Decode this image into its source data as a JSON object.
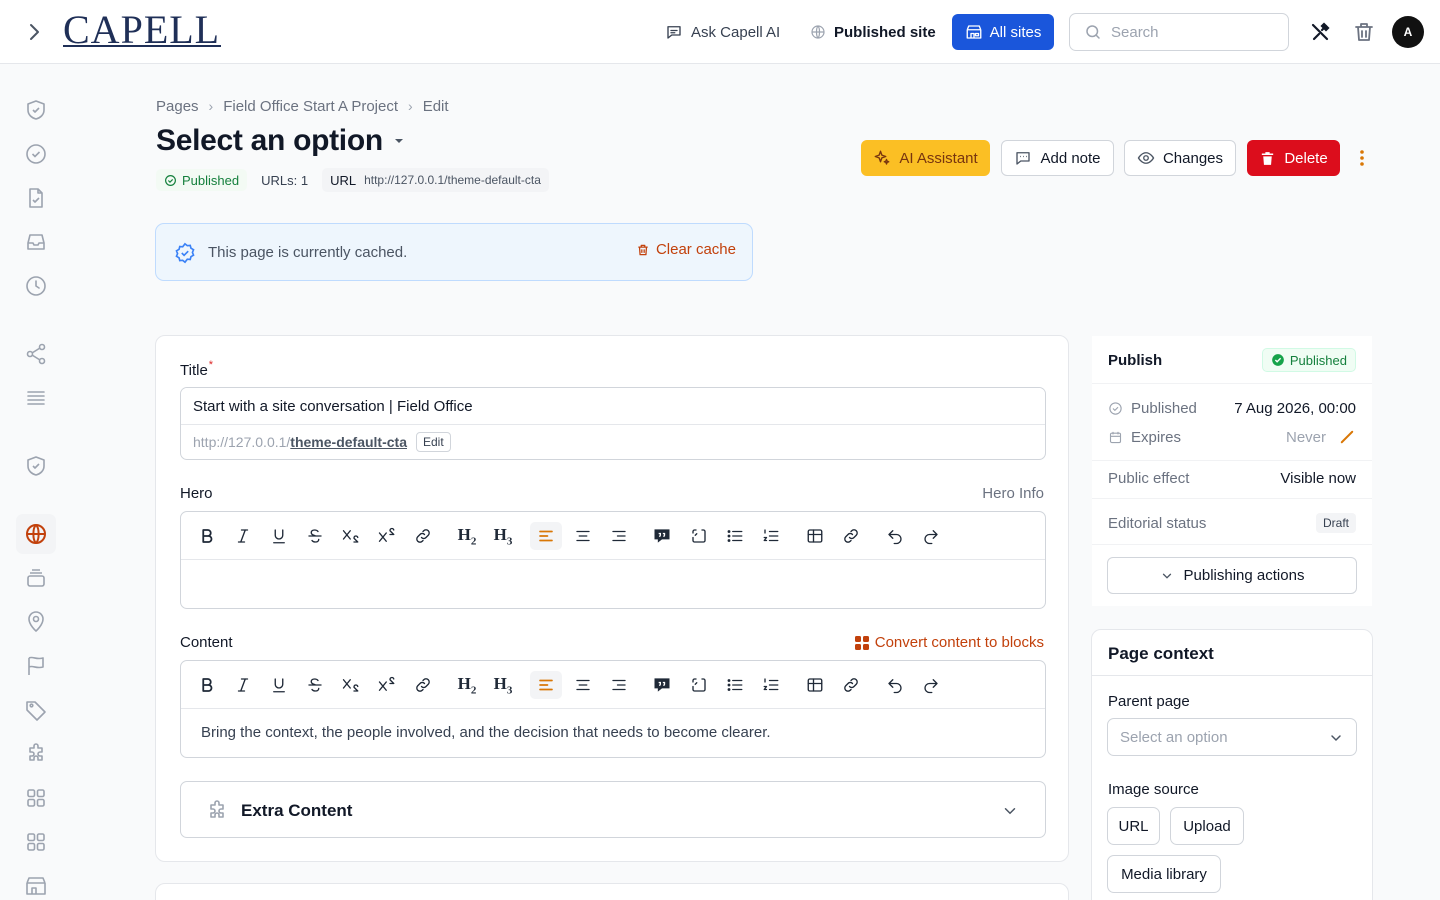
{
  "topbar": {
    "logo": "CAPELL",
    "ask_ai": "Ask Capell AI",
    "published_site": "Published site",
    "all_sites": "All sites",
    "search_placeholder": "Search",
    "avatar": "A"
  },
  "breadcrumb": [
    "Pages",
    "Field Office Start A Project",
    "Edit"
  ],
  "page": {
    "title": "Select an option",
    "status": "Published",
    "urls": "URLs: 1",
    "url_label": "URL",
    "url_value": "http://127.0.0.1/theme-default-cta"
  },
  "actions": {
    "ai": "AI Assistant",
    "note": "Add note",
    "changes": "Changes",
    "delete": "Delete"
  },
  "cache": {
    "text": "This page is currently cached.",
    "clear": "Clear cache"
  },
  "form": {
    "title_label": "Title",
    "title_value": "Start with a site conversation | Field Office",
    "slug_base": "http://127.0.0.1/",
    "slug": "theme-default-cta",
    "slug_edit": "Edit",
    "hero_label": "Hero",
    "hero_hint": "Hero Info",
    "content_label": "Content",
    "convert": "Convert content to blocks",
    "content_value": "Bring the context, the people involved, and the decision that needs to become clearer.",
    "extra": "Extra Content"
  },
  "publish": {
    "title": "Publish",
    "badge": "Published",
    "published_label": "Published",
    "published_value": "7 Aug 2026, 00:00",
    "expires_label": "Expires",
    "expires_value": "Never",
    "effect_label": "Public effect",
    "effect_value": "Visible now",
    "editorial_label": "Editorial status",
    "editorial_value": "Draft",
    "actions": "Publishing actions"
  },
  "context": {
    "title": "Page context",
    "parent_label": "Parent page",
    "parent_placeholder": "Select an option",
    "image_label": "Image source",
    "btn_url": "URL",
    "btn_upload": "Upload",
    "btn_media": "Media library"
  },
  "colors": {
    "accent": "#1a56db",
    "ai": "#fbbf24",
    "danger": "#dc0d1c",
    "success": "#15803d",
    "warn": "#c2410c"
  }
}
